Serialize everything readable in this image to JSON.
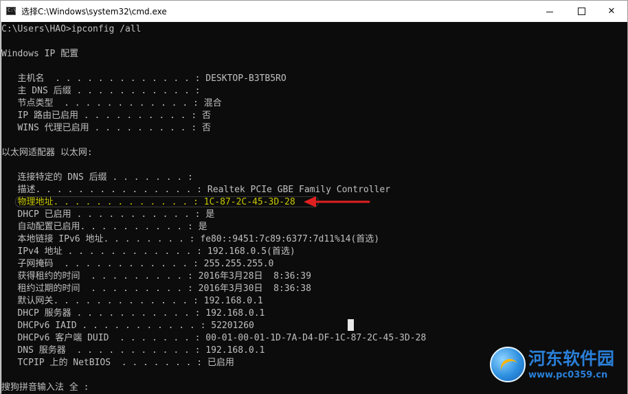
{
  "window": {
    "title": "选择C:\\Windows\\system32\\cmd.exe",
    "icon_label": "C:\\"
  },
  "controls": {
    "minimize": "minimize-icon",
    "maximize": "maximize-icon",
    "close_symbol": "✕"
  },
  "console": {
    "lines": [
      "C:\\Users\\HAO>ipconfig /all",
      "",
      "Windows IP 配置",
      "",
      "   主机名  . . . . . . . . . . . . . : DESKTOP-B3TB5RO",
      "   主 DNS 后缀 . . . . . . . . . . . :",
      "   节点类型  . . . . . . . . . . . . : 混合",
      "   IP 路由已启用 . . . . . . . . . . : 否",
      "   WINS 代理已启用 . . . . . . . . . : 否",
      "",
      "以太网适配器 以太网:",
      "",
      "   连接特定的 DNS 后缀 . . . . . . . :",
      "   描述. . . . . . . . . . . . . . . : Realtek PCIe GBE Family Controller",
      "   物理地址. . . . . . . . . . . . . : 1C-87-2C-45-3D-28",
      "   DHCP 已启用 . . . . . . . . . . . : 是",
      "   自动配置已启用. . . . . . . . . . : 是",
      "   本地链接 IPv6 地址. . . . . . . . : fe80::9451:7c89:6377:7d11%14(首选)",
      "   IPv4 地址 . . . . . . . . . . . . : 192.168.0.5(首选)",
      "   子网掩码  . . . . . . . . . . . . : 255.255.255.0",
      "   获得租约的时间  . . . . . . . . . : 2016年3月28日  8:36:39",
      "   租约过期的时间  . . . . . . . . . : 2016年3月30日  8:36:38",
      "   默认网关. . . . . . . . . . . . . : 192.168.0.1",
      "   DHCP 服务器 . . . . . . . . . . . : 192.168.0.1",
      "   DHCPv6 IAID . . . . . . . . . . . : 52201260",
      "   DHCPv6 客户端 DUID  . . . . . . . : 00-01-00-01-1D-7A-D4-DF-1C-87-2C-45-3D-28",
      "   DNS 服务器  . . . . . . . . . . . : 192.168.0.1",
      "   TCPIP 上的 NetBIOS  . . . . . . . : 已启用",
      "",
      "搜狗拼音输入法 全 :"
    ],
    "highlight_line_index": 14,
    "text_color": "#c0c0c0",
    "highlight_color": "#c8c800",
    "background": "#0c0c0c"
  },
  "annotation": {
    "arrow_color": "#e02020"
  },
  "watermark": {
    "name": "河东软件园",
    "url": "www.pc0359.cn"
  }
}
